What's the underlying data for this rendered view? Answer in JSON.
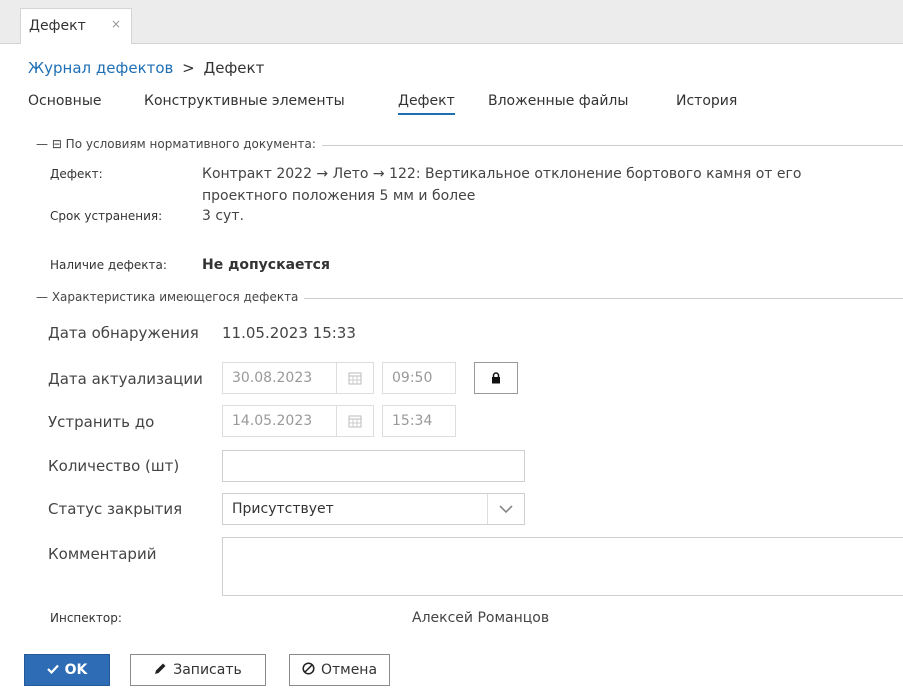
{
  "tab": {
    "title": "Дефект",
    "close": "×"
  },
  "breadcrumb": {
    "link": "Журнал дефектов",
    "separator": ">",
    "current": "Дефект"
  },
  "nav": [
    "Основные",
    "Конструктивные элементы",
    "Дефект",
    "Вложенные файлы",
    "История"
  ],
  "section1": {
    "legend": "— ⊟ По условиям нормативного документа:",
    "defect_label": "Дефект:",
    "defect_line1": "Контракт 2022 → Лето → 122: Вертикальное отклонение бортового камня от его",
    "defect_line2": "проектного положения 5 мм и более",
    "term_label": "Срок устранения:",
    "term_value": "3 сут.",
    "presence_label": "Наличие дефекта:",
    "presence_value": "Не допускается"
  },
  "section2": {
    "legend": "— Характеристика имеющегося дефекта",
    "detect_label": "Дата обнаружения",
    "detect_value": "11.05.2023 15:33",
    "actual_label": "Дата актуализации",
    "actual_date": "30.08.2023",
    "actual_time": "09:50",
    "fix_label": "Устранить до",
    "fix_date": "14.05.2023",
    "fix_time": "15:34",
    "qty_label": "Количество (шт)",
    "qty_value": "",
    "status_label": "Статус закрытия",
    "status_value": "Присутствует",
    "comment_label": "Комментарий",
    "comment_value": "",
    "inspector_label": "Инспектор:",
    "inspector_value": "Алексей Романцов"
  },
  "buttons": {
    "ok": "OK",
    "save": "Записать",
    "cancel": "Отмена"
  },
  "colors": {
    "accent": "#2e6db5",
    "link": "#1f6fb5"
  },
  "icons": {
    "ok": "check-icon",
    "save": "pencil-icon",
    "cancel": "cancel-circle-icon",
    "calendar": "calendar-icon",
    "lock": "lock-icon",
    "dropdown": "chevron-down-icon"
  }
}
